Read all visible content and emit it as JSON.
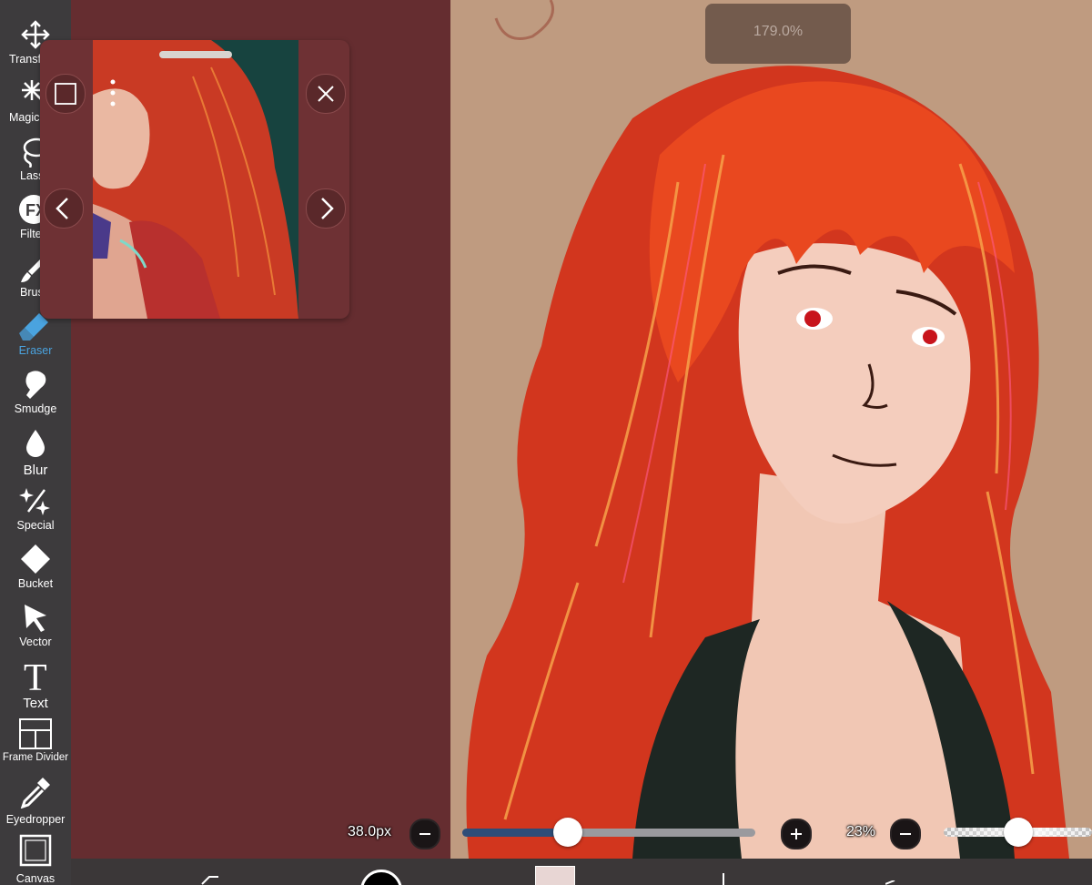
{
  "toolbar": {
    "tools": [
      {
        "label": "Transform",
        "icon": "move-arrows-icon"
      },
      {
        "label": "Magic Wand",
        "icon": "magic-wand-icon"
      },
      {
        "label": "Lasso",
        "icon": "lasso-icon"
      },
      {
        "label": "Filter",
        "icon": "fx-icon"
      },
      {
        "label": "Brush",
        "icon": "brush-icon"
      },
      {
        "label": "Eraser",
        "icon": "eraser-icon",
        "active": true
      },
      {
        "label": "Smudge",
        "icon": "smudge-icon"
      },
      {
        "label": "Blur",
        "icon": "blur-drop-icon"
      },
      {
        "label": "Special",
        "icon": "sparkle-icon"
      },
      {
        "label": "Bucket",
        "icon": "bucket-icon"
      },
      {
        "label": "Vector",
        "icon": "cursor-arrow-icon"
      },
      {
        "label": "Text",
        "icon": "text-t-icon"
      },
      {
        "label": "Frame Divider",
        "icon": "frame-divider-icon"
      },
      {
        "label": "Eyedropper",
        "icon": "eyedropper-icon"
      },
      {
        "label": "Canvas",
        "icon": "canvas-icon"
      }
    ],
    "active_color": "#4aa3df"
  },
  "canvas": {
    "zoom": "179.0%",
    "background_color": "#bf9b80",
    "workspace_color": "#652d30"
  },
  "reference_window": {
    "expand_icon": "square-icon",
    "menu_icon": "vertical-dots-icon",
    "close_icon": "close-x-icon",
    "prev_icon": "chevron-left-icon",
    "next_icon": "chevron-right-icon"
  },
  "brush_controls": {
    "size": "38.0px",
    "size_fraction": 0.36,
    "opacity": "23%",
    "opacity_fraction": 0.5,
    "minus_icon": "minus-icon",
    "plus_icon": "plus-icon"
  }
}
